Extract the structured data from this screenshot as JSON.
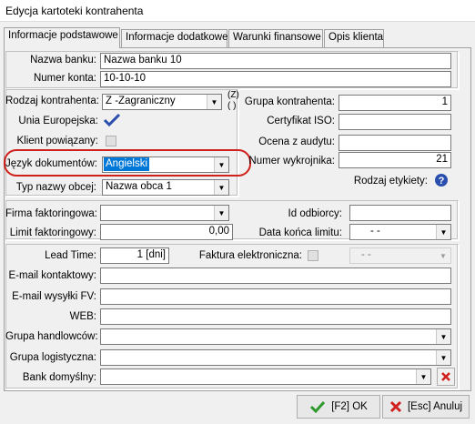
{
  "window": {
    "title": "Edycja kartoteki kontrahenta"
  },
  "tabs": [
    {
      "label": "Informacje podstawowe"
    },
    {
      "label": "Informacje dodatkowe"
    },
    {
      "label": "Warunki finansowe"
    },
    {
      "label": "Opis klienta"
    }
  ],
  "bank": {
    "name_label": "Nazwa banku:",
    "name_value": "Nazwa banku 10",
    "account_label": "Numer konta:",
    "account_value": "10-10-10"
  },
  "left": {
    "rodzaj_label": "Rodzaj kontrahenta:",
    "rodzaj_value": "Z -Zagraniczny",
    "rodzaj_code_a": "(Z)",
    "rodzaj_code_b": "( )",
    "unia_label": "Unia Europejska:",
    "klient_label": "Klient powiązany:",
    "jezyk_label": "Język dokumentów:",
    "jezyk_value": "Angielski",
    "typ_label": "Typ nazwy obcej:",
    "typ_value": "Nazwa obca 1"
  },
  "right": {
    "grupa_label": "Grupa kontrahenta:",
    "grupa_value": "1",
    "cert_label": "Certyfikat ISO:",
    "cert_value": "",
    "ocena_label": "Ocena z audytu:",
    "ocena_value": "",
    "wykrojnik_label": "Numer wykrojnika:",
    "wykrojnik_value": "21",
    "etykiety_label": "Rodzaj etykiety:"
  },
  "factoring": {
    "firma_label": "Firma faktoringowa:",
    "firma_value": "",
    "limit_label": "Limit faktoringowy:",
    "limit_value": "0,00",
    "odbiorca_label": "Id odbiorcy:",
    "odbiorca_value": "",
    "data_label": "Data końca limitu:",
    "data_value": " -  - "
  },
  "contact": {
    "lead_label": "Lead Time:",
    "lead_value": "1 [dni]",
    "faktura_label": "Faktura elektroniczna:",
    "faktura_value": " -  - ",
    "email_kontakt_label": "E-mail kontaktowy:",
    "email_wysylki_label": "E-mail wysyłki FV:",
    "web_label": "WEB:",
    "grupa_handl_label": "Grupa handlowców:",
    "grupa_log_label": "Grupa logistyczna:",
    "bank_dom_label": "Bank domyślny:"
  },
  "buttons": {
    "ok_label": "[F2] OK",
    "cancel_label": "[Esc] Anuluj"
  },
  "colors": {
    "highlight_oval": "#d0201a",
    "selection": "#0078d7",
    "ok_icon": "#2e9a2e",
    "cancel_icon": "#d02020",
    "clear_icon": "#d02020"
  }
}
